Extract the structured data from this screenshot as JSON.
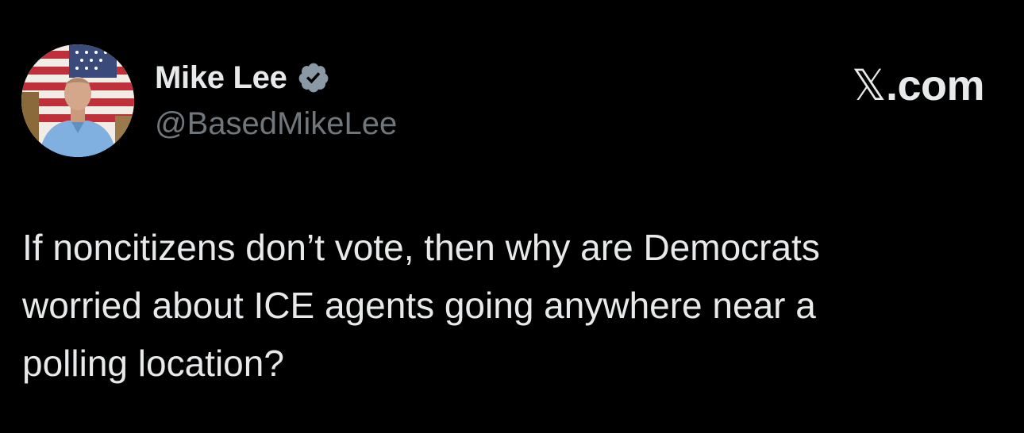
{
  "author": {
    "display_name": "Mike Lee",
    "handle": "@BasedMikeLee",
    "verified": true,
    "verified_badge_color": "#8b98a5"
  },
  "site": {
    "label_x": "𝕏",
    "label_rest": ".com"
  },
  "tweet": {
    "lines": [
      "If noncitizens don’t vote, then why are Democrats",
      "worried about ICE agents going anywhere near a",
      "polling location?"
    ]
  },
  "colors": {
    "background": "#000000",
    "primary_text": "#e7e9ea",
    "secondary_text": "#71767b"
  }
}
